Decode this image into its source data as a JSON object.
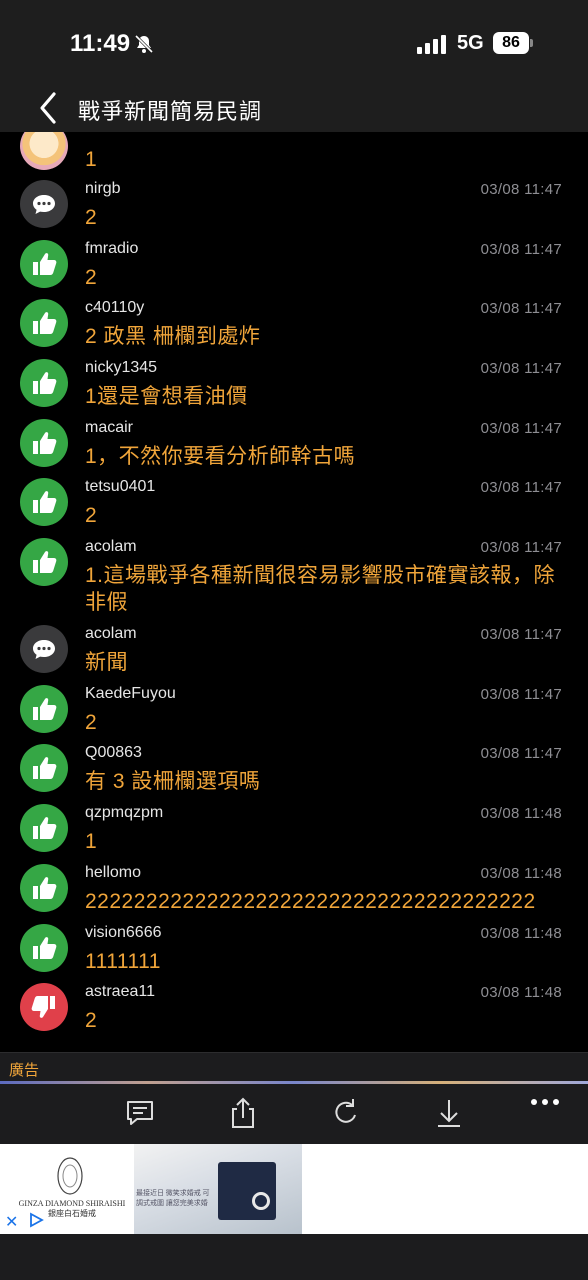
{
  "status": {
    "time": "11:49",
    "network": "5G",
    "battery": "86"
  },
  "header": {
    "title": "戰爭新聞簡易民調"
  },
  "comments": [
    {
      "type": "img",
      "user": "",
      "time": "",
      "text": "1"
    },
    {
      "type": "comment",
      "user": "nirgb",
      "time": "03/08 11:47",
      "text": "2"
    },
    {
      "type": "up",
      "user": "fmradio",
      "time": "03/08 11:47",
      "text": "2"
    },
    {
      "type": "up",
      "user": "c40110y",
      "time": "03/08 11:47",
      "text": "2 政黑 柵欄到處炸"
    },
    {
      "type": "up",
      "user": "nicky1345",
      "time": "03/08 11:47",
      "text": "1還是會想看油價"
    },
    {
      "type": "up",
      "user": "macair",
      "time": "03/08 11:47",
      "text": "1，不然你要看分析師幹古嗎"
    },
    {
      "type": "up",
      "user": "tetsu0401",
      "time": "03/08 11:47",
      "text": "2"
    },
    {
      "type": "up",
      "user": "acolam",
      "time": "03/08 11:47",
      "text": "1.這場戰爭各種新聞很容易影響股市確實該報，除非假"
    },
    {
      "type": "comment",
      "user": "acolam",
      "time": "03/08 11:47",
      "text": "新聞"
    },
    {
      "type": "up",
      "user": "KaedeFuyou",
      "time": "03/08 11:47",
      "text": "2"
    },
    {
      "type": "up",
      "user": "Q00863",
      "time": "03/08 11:47",
      "text": "有 3 設柵欄選項嗎"
    },
    {
      "type": "up",
      "user": "qzpmqzpm",
      "time": "03/08 11:48",
      "text": "1"
    },
    {
      "type": "up",
      "user": "hellomo",
      "time": "03/08 11:48",
      "text": "2222222222222222222222222222222222222"
    },
    {
      "type": "up",
      "user": "vision6666",
      "time": "03/08 11:48",
      "text": "1111111"
    },
    {
      "type": "down",
      "user": "astraea11",
      "time": "03/08 11:48",
      "text": "2"
    }
  ],
  "ad": {
    "label": "廣告",
    "brand": "GINZA DIAMOND SHIRAISHI",
    "brand_sub": "銀座白石婚戒",
    "copy": "最接近日 微笑求婚戒 可調式戒圍 讓您完美求婚"
  },
  "icons": {
    "back": "chevron-left-icon",
    "comment": "speech-bubble-icon",
    "share": "share-icon",
    "refresh": "refresh-icon",
    "download": "download-icon",
    "more": "ellipsis-icon"
  }
}
